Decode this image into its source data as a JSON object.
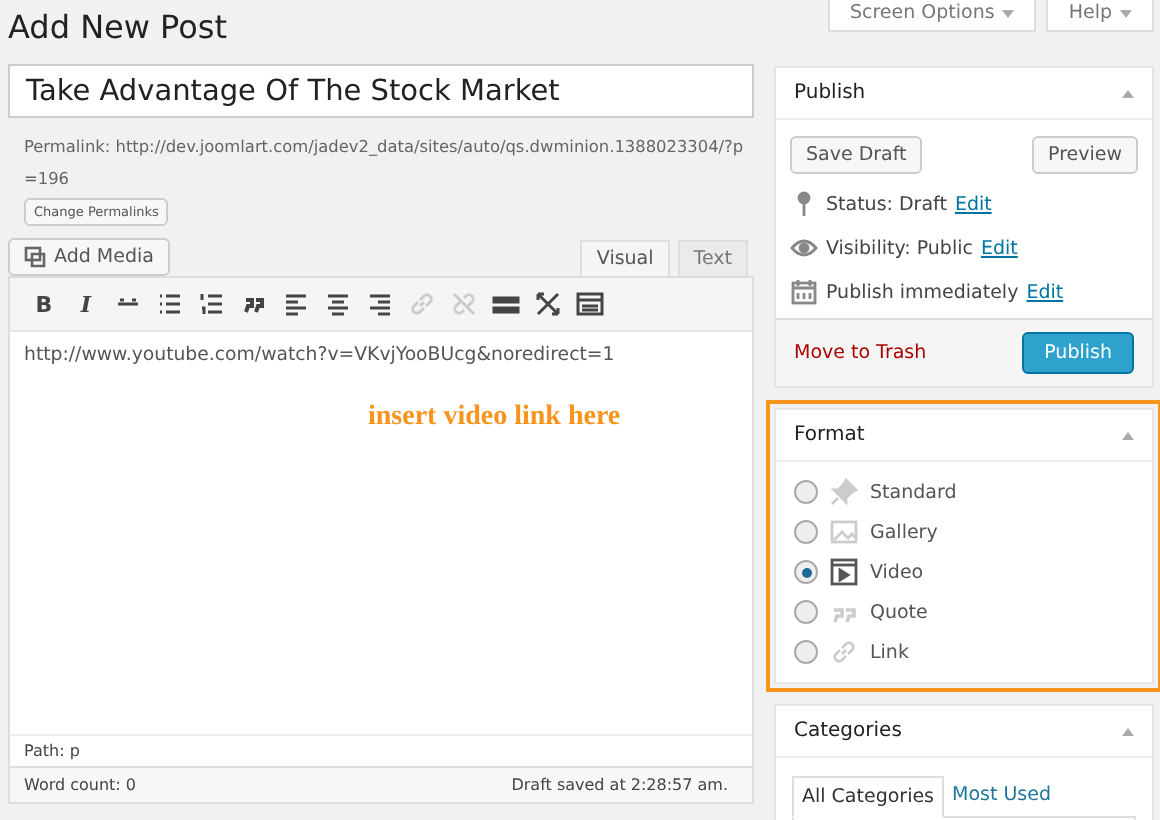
{
  "header": {
    "title": "Add New Post",
    "buttons": [
      {
        "label": "Screen Options"
      },
      {
        "label": "Help"
      }
    ]
  },
  "post_title": {
    "value": "Take Advantage Of The Stock Market"
  },
  "permalink": {
    "label": "Permalink:",
    "url": "http://dev.joomlart.com/jadev2_data/sites/auto/qs.dwminion.1388023304/?p=196",
    "button": "Change Permalinks"
  },
  "add_media": "Add Media",
  "editor_tabs": [
    {
      "label": "Visual",
      "selected": true
    },
    {
      "label": "Text",
      "selected": false
    }
  ],
  "toolbar": [
    {
      "kind": "bold",
      "label": "B",
      "disabled": false
    },
    {
      "kind": "italic",
      "label": "I",
      "disabled": false
    },
    {
      "kind": "strike",
      "disabled": false
    },
    {
      "kind": "bullets",
      "disabled": false
    },
    {
      "kind": "numbers",
      "disabled": false
    },
    {
      "kind": "quote",
      "disabled": false
    },
    {
      "kind": "align-left",
      "disabled": false
    },
    {
      "kind": "align-center",
      "disabled": false
    },
    {
      "kind": "align-right",
      "disabled": false
    },
    {
      "kind": "link",
      "disabled": true
    },
    {
      "kind": "unlink",
      "disabled": true
    },
    {
      "kind": "more",
      "disabled": false
    },
    {
      "kind": "fullscreen",
      "disabled": false
    },
    {
      "kind": "kitchen-sink",
      "disabled": false
    }
  ],
  "content": "http://www.youtube.com/watch?v=VKvjYooBUcg&noredirect=1",
  "annotation": "insert video link here",
  "path": "Path: p",
  "word_count": "Word count: 0",
  "draft_saved": "Draft saved at 2:28:57 am.",
  "publish": {
    "title": "Publish",
    "save_draft": "Save Draft",
    "preview": "Preview",
    "rows": [
      {
        "kind": "status",
        "label": "Status: Draft",
        "link": "Edit"
      },
      {
        "kind": "visibility",
        "label": "Visibility: Public",
        "link": "Edit"
      },
      {
        "kind": "schedule",
        "label": "Publish immediately",
        "link": "Edit"
      }
    ],
    "trash": "Move to Trash",
    "button": "Publish"
  },
  "format": {
    "title": "Format",
    "highlighted": true,
    "options": [
      {
        "kind": "standard",
        "label": "Standard",
        "selected": false
      },
      {
        "kind": "gallery",
        "label": "Gallery",
        "selected": false
      },
      {
        "kind": "video",
        "label": "Video",
        "selected": true
      },
      {
        "kind": "quote",
        "label": "Quote",
        "selected": false
      },
      {
        "kind": "link",
        "label": "Link",
        "selected": false
      }
    ]
  },
  "categories": {
    "title": "Categories",
    "tabs": [
      {
        "label": "All Categories",
        "selected": true
      },
      {
        "label": "Most Used",
        "selected": false
      }
    ]
  }
}
